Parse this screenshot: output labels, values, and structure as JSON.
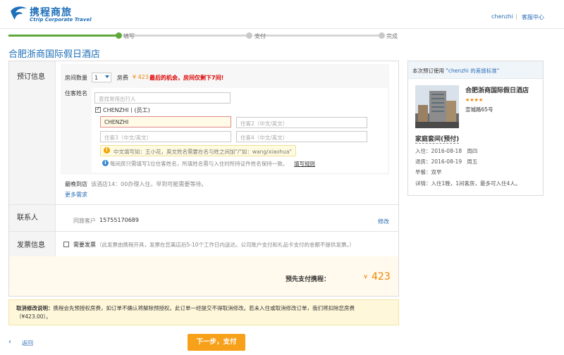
{
  "header": {
    "logo_title": "携程商旅",
    "logo_subtitle": "Ctrip Corporate Travel",
    "user": "chenzhi",
    "separator": "|",
    "service": "客服中心"
  },
  "steps": [
    {
      "label": "填写",
      "state": "current"
    },
    {
      "label": "支付",
      "state": "todo"
    },
    {
      "label": "完成",
      "state": "todo"
    }
  ],
  "hotel_title": "合肥浙商国际假日酒店",
  "booking": {
    "section_title": "预订信息",
    "room_count_label": "房间数量",
    "room_count_value": "1",
    "room_price_label": "房费",
    "room_price_value": "¥ 423",
    "urgency": "最后的机会，房间仅剩下7间!",
    "guest_label": "住客姓名",
    "search_placeholder": "查找常用出行人",
    "selected_guest": "CHENZHI丨(员工)",
    "guest1_value": "CHENZHI",
    "guest2_placeholder": "住客2（中文/英文）",
    "guest3_placeholder": "住客3（中文/英文）",
    "guest4_placeholder": "住客4（中文/英文）",
    "tip_icon": "!",
    "tip_text": "中文填写如：王小花，英文姓名需要在名与姓之间加\"/\"如：wang/xiaohua\"",
    "info_icon": "i",
    "note_text": "每间房只需填写1位住客姓名，所填姓名需与入住时所持证件姓名保持一致。",
    "rule_link": "填写规则",
    "arrival_label": "最晚到店",
    "arrival_text": "该酒店14：00办理入住，早到可能需要等待。",
    "more_link": "更多需求"
  },
  "contact": {
    "section_title": "联系人",
    "name": "同旅客户",
    "phone": "15755170689",
    "edit_link": "修改"
  },
  "invoice": {
    "section_title": "发票信息",
    "checkbox_label": "需要发票",
    "note": "（此发票由携程开具，发票在您离店后5-10个工作日内送达。公司账户支付和礼品卡支付的金额不提供发票。）"
  },
  "payment": {
    "label": "预先支付携程：",
    "currency": "¥",
    "amount": "423"
  },
  "cancel_policy": {
    "title": "取消修改说明：",
    "line1": "携程会先预授权房费，如订单不确认将解除预授权。此订单一经提交不得取消修改。若未入住或取消修改订单，我们将扣除您房费",
    "line2": "（¥423.00）。"
  },
  "footer": {
    "back_arrow": "‹",
    "back_link": "返回",
    "next_button": "下一步，支付"
  },
  "card": {
    "policy_prefix": "本次预订使用",
    "policy_link": "\"chenzhi 的差旅标准\"",
    "hotel_name": "合肥浙商国际假日酒店",
    "stars": "★★★★",
    "star_count": 4,
    "address": "宣城路65号",
    "room_type": "家庭套间(预付)",
    "checkin_label": "入住：",
    "checkin_date": "2016-08-18",
    "checkin_day": "周四",
    "checkout_label": "退房：",
    "checkout_date": "2016-08-19",
    "checkout_day": "周五",
    "breakfast_label": "早餐：",
    "breakfast_value": "双早",
    "details_label": "详情：",
    "details_value": "入住1晚，1间客房，最多可入住4人。"
  },
  "colors": {
    "brand_blue": "#1d6fb8",
    "progress_green": "#5fa93a",
    "price_orange": "#f08300",
    "urgent_red": "#dd0000",
    "button_orange": "#f7a11a"
  }
}
